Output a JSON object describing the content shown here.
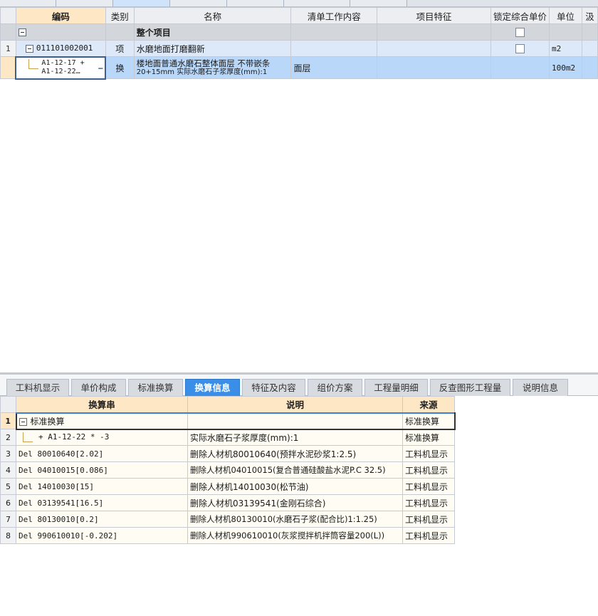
{
  "top_grid": {
    "headers": {
      "code": "编码",
      "type": "类别",
      "name": "名称",
      "work_content": "清单工作内容",
      "feature": "项目特征",
      "lock_price": "锁定综合单价",
      "unit": "单位",
      "extra": "汲"
    },
    "rows": {
      "total": {
        "name": "整个项目"
      },
      "item": {
        "row_num": "1",
        "code": "011101002001",
        "type": "项",
        "name": "水磨地面打磨翻新",
        "unit": "m2"
      },
      "sub": {
        "code_line1": "A1-12-17 +",
        "code_line2": "A1-12-22…",
        "more": "…",
        "type": "换",
        "name_line1": "楼地面普通水磨石整体面层 不带嵌条",
        "name_line2": "20+15mm  实际水磨石子浆厚度(mm):1",
        "work_content": "面层",
        "unit": "100m2"
      }
    }
  },
  "bottom_tabs": [
    {
      "label": "工料机显示"
    },
    {
      "label": "单价构成"
    },
    {
      "label": "标准换算"
    },
    {
      "label": "换算信息",
      "active": true
    },
    {
      "label": "特征及内容"
    },
    {
      "label": "组价方案"
    },
    {
      "label": "工程量明细"
    },
    {
      "label": "反查图形工程量"
    },
    {
      "label": "说明信息"
    }
  ],
  "bottom_grid": {
    "headers": {
      "expr": "换算串",
      "desc": "说明",
      "source": "来源"
    },
    "rows": [
      {
        "n": "1",
        "expr": "标准换算",
        "desc": "",
        "source": "标准换算"
      },
      {
        "n": "2",
        "expr": "+ A1-12-22 * -3",
        "desc": "实际水磨石子浆厚度(mm):1",
        "source": "标准换算"
      },
      {
        "n": "3",
        "expr": "Del 80010640[2.02]",
        "desc": "删除人材机80010640(预拌水泥砂浆1:2.5)",
        "source": "工料机显示"
      },
      {
        "n": "4",
        "expr": "Del 04010015[0.086]",
        "desc": "删除人材机04010015(复合普通硅酸盐水泥P.C 32.5)",
        "source": "工料机显示"
      },
      {
        "n": "5",
        "expr": "Del 14010030[15]",
        "desc": "删除人材机14010030(松节油)",
        "source": "工料机显示"
      },
      {
        "n": "6",
        "expr": "Del 03139541[16.5]",
        "desc": "删除人材机03139541(金刚石综合)",
        "source": "工料机显示"
      },
      {
        "n": "7",
        "expr": "Del 80130010[0.2]",
        "desc": "删除人材机80130010(水磨石子浆(配合比)1:1.25)",
        "source": "工料机显示"
      },
      {
        "n": "8",
        "expr": "Del 990610010[-0.202]",
        "desc": "删除人材机990610010(灰浆搅拌机拌筒容量200(L))",
        "source": "工料机显示"
      }
    ]
  }
}
